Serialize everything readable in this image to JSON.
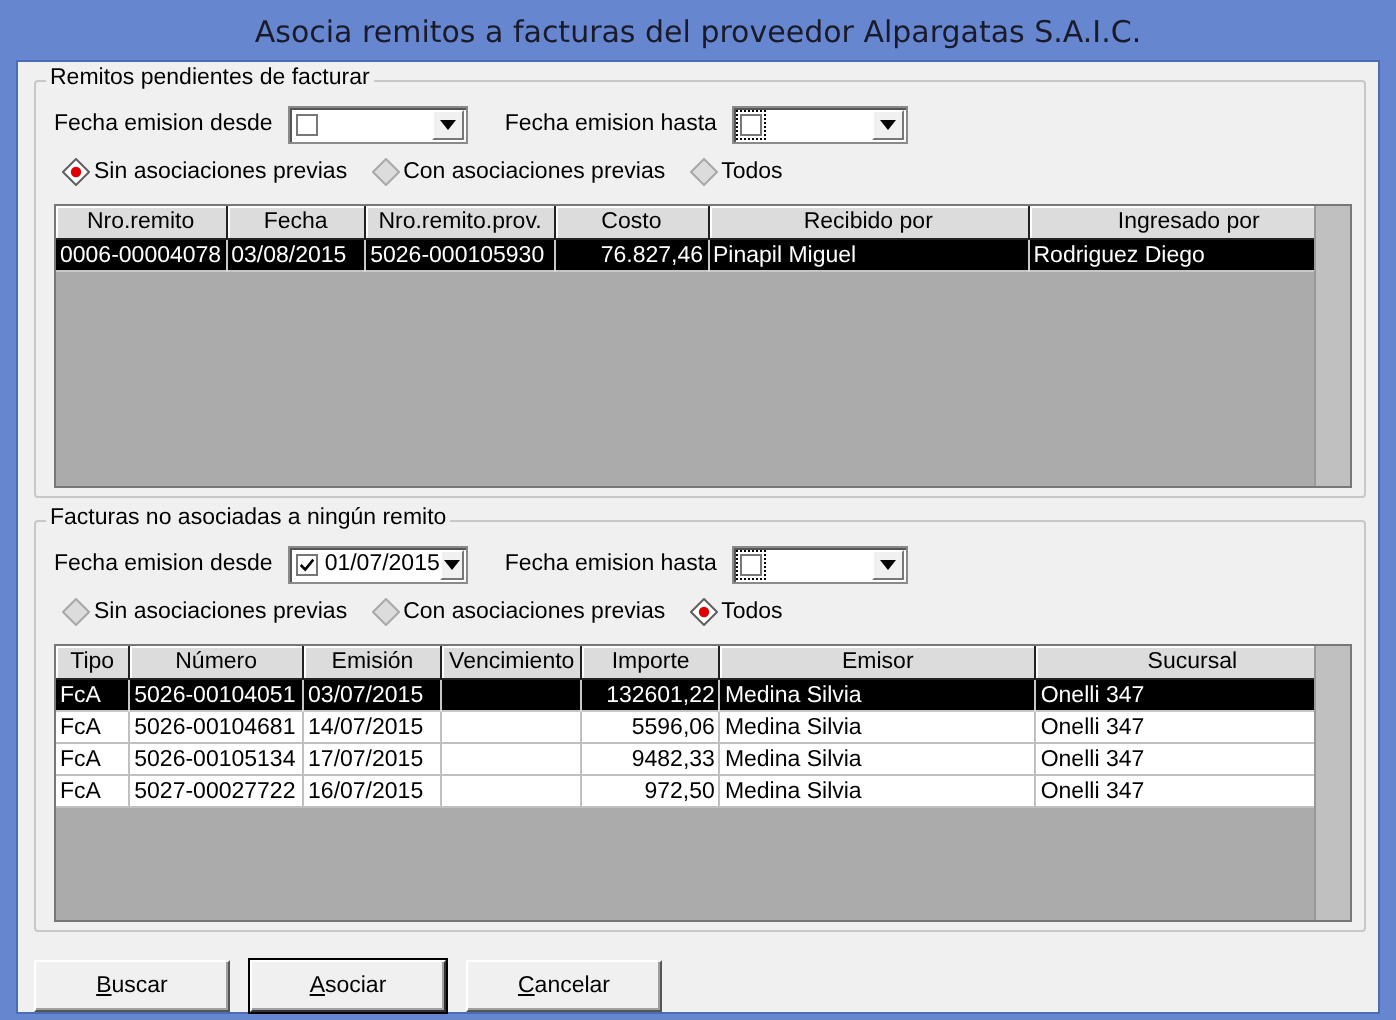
{
  "window": {
    "title": "Asocia remitos a facturas del proveedor Alpargatas S.A.I.C."
  },
  "groups": [
    {
      "legend": "Remitos pendientes de facturar",
      "date_from": {
        "label": "Fecha emision desde",
        "checked": false
      },
      "date_to": {
        "label": "Fecha emision hasta",
        "checked": false
      },
      "radios": [
        {
          "label": "Sin asociaciones previas",
          "selected": true
        },
        {
          "label": "Con asociaciones previas",
          "selected": false
        },
        {
          "label": "Todos",
          "selected": false
        }
      ],
      "table": {
        "columns": [
          {
            "label": "Nro.remito",
            "kind": "text"
          },
          {
            "label": "Fecha",
            "kind": "text"
          },
          {
            "label": "Nro.remito.prov.",
            "kind": "text"
          },
          {
            "label": "Costo",
            "kind": "numeric"
          },
          {
            "label": "Recibido por",
            "kind": "text"
          },
          {
            "label": "Ingresado por",
            "kind": "text"
          }
        ],
        "rows": [
          {
            "selected": true,
            "cells": [
              "0006-00004078",
              "03/08/2015",
              "5026-000105930",
              "76.827,46",
              "Pinapil Miguel",
              "Rodriguez Diego"
            ]
          }
        ]
      }
    },
    {
      "legend": "Facturas no asociadas a ningún remito",
      "date_from": {
        "label": "Fecha emision desde",
        "checked": true,
        "value": "01/07/2015"
      },
      "date_to": {
        "label": "Fecha emision hasta",
        "checked": false
      },
      "radios": [
        {
          "label": "Sin asociaciones previas",
          "selected": false
        },
        {
          "label": "Con asociaciones previas",
          "selected": false
        },
        {
          "label": "Todos",
          "selected": true
        }
      ],
      "table": {
        "columns": [
          {
            "label": "Tipo",
            "kind": "text"
          },
          {
            "label": "Número",
            "kind": "text"
          },
          {
            "label": "Emisión",
            "kind": "text"
          },
          {
            "label": "Vencimiento",
            "kind": "text"
          },
          {
            "label": "Importe",
            "kind": "numeric"
          },
          {
            "label": "Emisor",
            "kind": "text"
          },
          {
            "label": "Sucursal",
            "kind": "text"
          }
        ],
        "rows": [
          {
            "selected": true,
            "cells": [
              "FcA",
              "5026-00104051",
              "03/07/2015",
              "",
              "132601,22",
              "Medina Silvia",
              "Onelli 347"
            ]
          },
          {
            "selected": false,
            "cells": [
              "FcA",
              "5026-00104681",
              "14/07/2015",
              "",
              "5596,06",
              "Medina Silvia",
              "Onelli 347"
            ]
          },
          {
            "selected": false,
            "cells": [
              "FcA",
              "5026-00105134",
              "17/07/2015",
              "",
              "9482,33",
              "Medina Silvia",
              "Onelli 347"
            ]
          },
          {
            "selected": false,
            "cells": [
              "FcA",
              "5027-00027722",
              "16/07/2015",
              "",
              "972,50",
              "Medina Silvia",
              "Onelli 347"
            ]
          }
        ]
      }
    }
  ],
  "buttons": [
    {
      "label": "Buscar",
      "default": false
    },
    {
      "label": "Asociar",
      "default": true
    },
    {
      "label": "Cancelar",
      "default": false
    }
  ]
}
